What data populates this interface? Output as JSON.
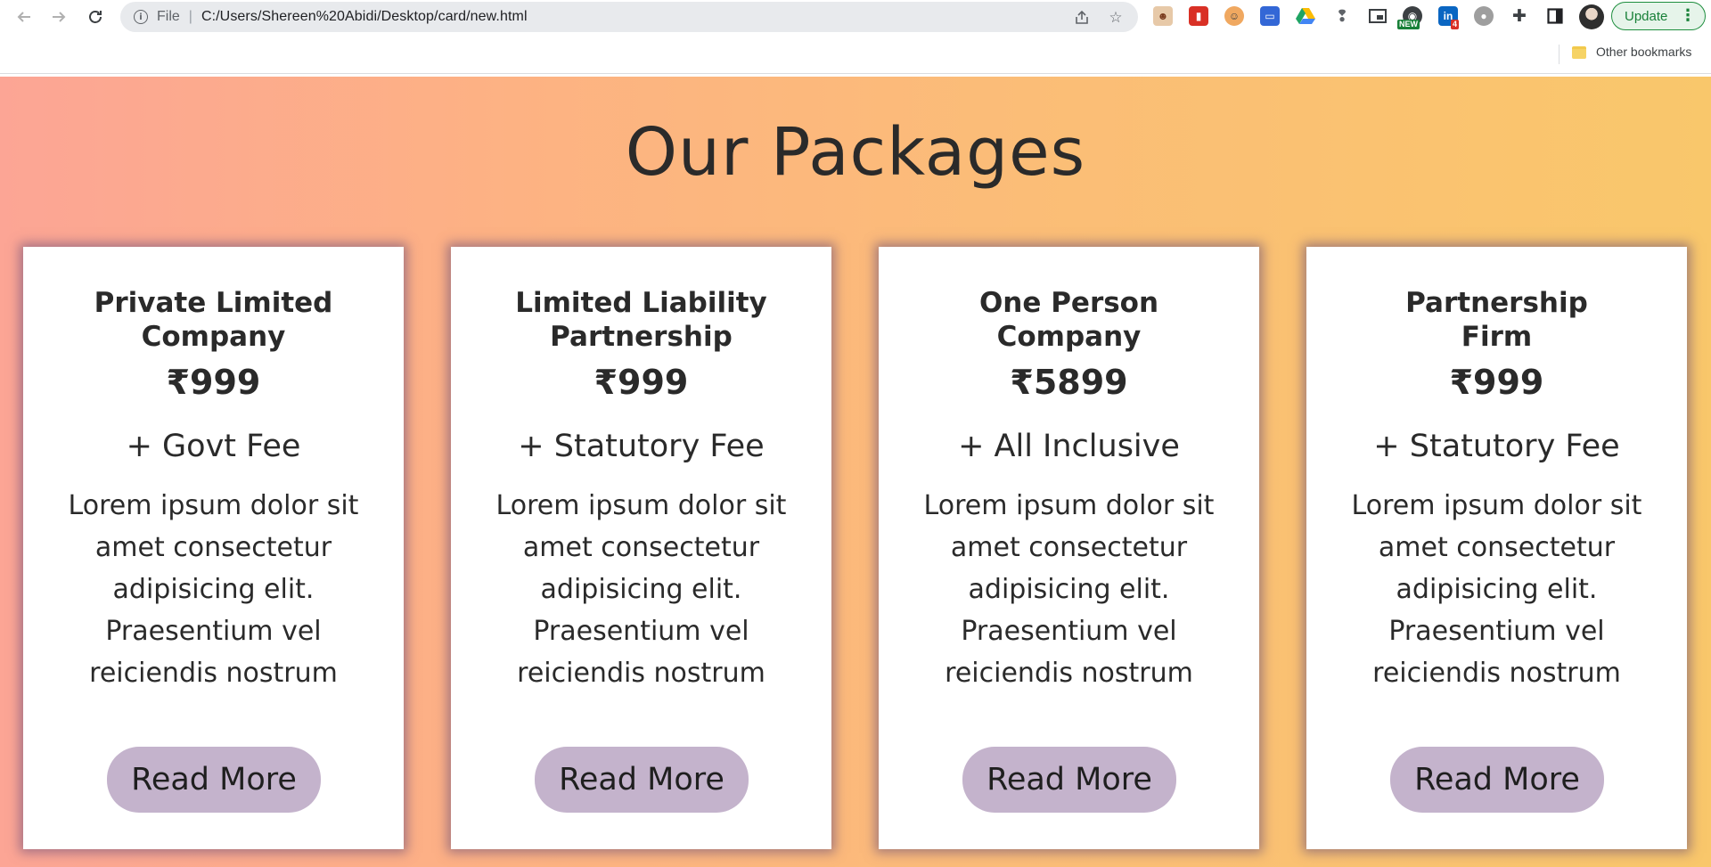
{
  "browser": {
    "scheme_label": "File",
    "url": "C:/Users/Shereen%20Abidi/Desktop/card/new.html",
    "extensions": [
      {
        "name": "reading-extension-icon",
        "color": "#c77b5a",
        "badge": ""
      },
      {
        "name": "red-book-extension-icon",
        "color": "#d93025",
        "badge": ""
      },
      {
        "name": "face-extension-icon",
        "color": "#e58c3a",
        "badge": ""
      },
      {
        "name": "blue-window-extension-icon",
        "color": "#3367d6",
        "badge": ""
      },
      {
        "name": "google-drive-icon",
        "color": "#1fa463",
        "badge": ""
      },
      {
        "name": "bulb-extension-icon",
        "color": "#5f6368",
        "badge": ""
      },
      {
        "name": "picture-in-picture-icon",
        "color": "#3c4043",
        "badge": ""
      },
      {
        "name": "new-badge-extension-icon",
        "color": "#1a73e8",
        "badge": "NEW"
      },
      {
        "name": "linkedin-extension-icon",
        "color": "#0a66c2",
        "badge": "4"
      },
      {
        "name": "onion-extension-icon",
        "color": "#7e7e7e",
        "badge": ""
      }
    ],
    "update_label": "Update",
    "menu_glyph": "⋮",
    "bookmark_folder_label": "Other bookmarks"
  },
  "page": {
    "title": "Our Packages",
    "cards": [
      {
        "title_line1": "Private Limited",
        "title_line2": "Company",
        "price": "₹999",
        "fee": "+ Govt Fee",
        "description": "Lorem ipsum dolor sit amet consectetur adipisicing elit. Praesentium vel reiciendis nostrum",
        "button_label": "Read More"
      },
      {
        "title_line1": "Limited Liability",
        "title_line2": "Partnership",
        "price": "₹999",
        "fee": "+ Statutory Fee",
        "description": "Lorem ipsum dolor sit amet consectetur adipisicing elit. Praesentium vel reiciendis nostrum",
        "button_label": "Read More"
      },
      {
        "title_line1": "One Person",
        "title_line2": "Company",
        "price": "₹5899",
        "fee": "+ All Inclusive",
        "description": "Lorem ipsum dolor sit amet consectetur adipisicing elit. Praesentium vel reiciendis nostrum",
        "button_label": "Read More"
      },
      {
        "title_line1": "Partnership",
        "title_line2": "Firm",
        "price": "₹999",
        "fee": "+ Statutory Fee",
        "description": "Lorem ipsum dolor sit amet consectetur adipisicing elit. Praesentium vel reiciendis nostrum",
        "button_label": "Read More"
      }
    ]
  },
  "colors": {
    "gradient_start": "#fca595",
    "gradient_end": "#f9c76b",
    "button_bg": "#c4b3cc",
    "text": "#2a2a2a",
    "update_green": "#188038"
  }
}
